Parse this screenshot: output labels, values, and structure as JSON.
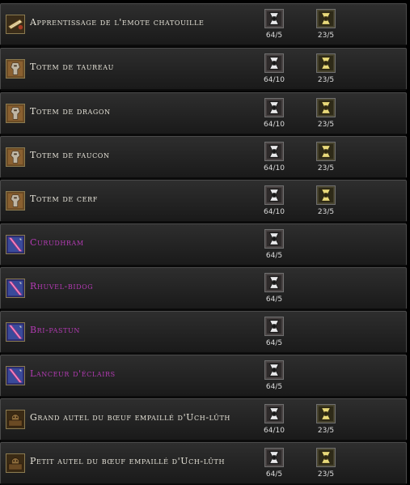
{
  "colors": {
    "normal_name": "#e6e3d8",
    "rare_name": "#b33ab3",
    "row_background": "#252525"
  },
  "currencies": {
    "a": "silver-hourglass-token-icon",
    "b": "gold-hourglass-token-icon"
  },
  "rows": [
    {
      "name": "Apprentissage de l'emote chatouille",
      "icon": "scroll-icon",
      "rarity": "normal",
      "cost_a": "64/5",
      "cost_b": "23/5"
    },
    {
      "name": "Totem de taureau",
      "icon": "totem-icon",
      "rarity": "normal",
      "cost_a": "64/10",
      "cost_b": "23/5"
    },
    {
      "name": "Totem de dragon",
      "icon": "totem-icon",
      "rarity": "normal",
      "cost_a": "64/10",
      "cost_b": "23/5"
    },
    {
      "name": "Totem de faucon",
      "icon": "totem-icon",
      "rarity": "normal",
      "cost_a": "64/10",
      "cost_b": "23/5"
    },
    {
      "name": "Totem de cerf",
      "icon": "totem-icon",
      "rarity": "normal",
      "cost_a": "64/10",
      "cost_b": "23/5"
    },
    {
      "name": "Curudhram",
      "icon": "weapon-icon",
      "rarity": "rare",
      "cost_a": "64/5",
      "cost_b": null
    },
    {
      "name": "Rhuvel-bidog",
      "icon": "weapon-icon",
      "rarity": "rare",
      "cost_a": "64/5",
      "cost_b": null
    },
    {
      "name": "Bri-pastun",
      "icon": "weapon-icon",
      "rarity": "rare",
      "cost_a": "64/5",
      "cost_b": null
    },
    {
      "name": "Lanceur d'éclairs",
      "icon": "weapon-icon",
      "rarity": "rare",
      "cost_a": "64/5",
      "cost_b": null
    },
    {
      "name": "Grand autel du bœuf empaillé d'Uch-lûth",
      "icon": "altar-icon",
      "rarity": "normal",
      "cost_a": "64/10",
      "cost_b": "23/5"
    },
    {
      "name": "Petit autel du bœuf empaillé d'Uch-lûth",
      "icon": "altar-icon",
      "rarity": "normal",
      "cost_a": "64/5",
      "cost_b": "23/5"
    }
  ]
}
